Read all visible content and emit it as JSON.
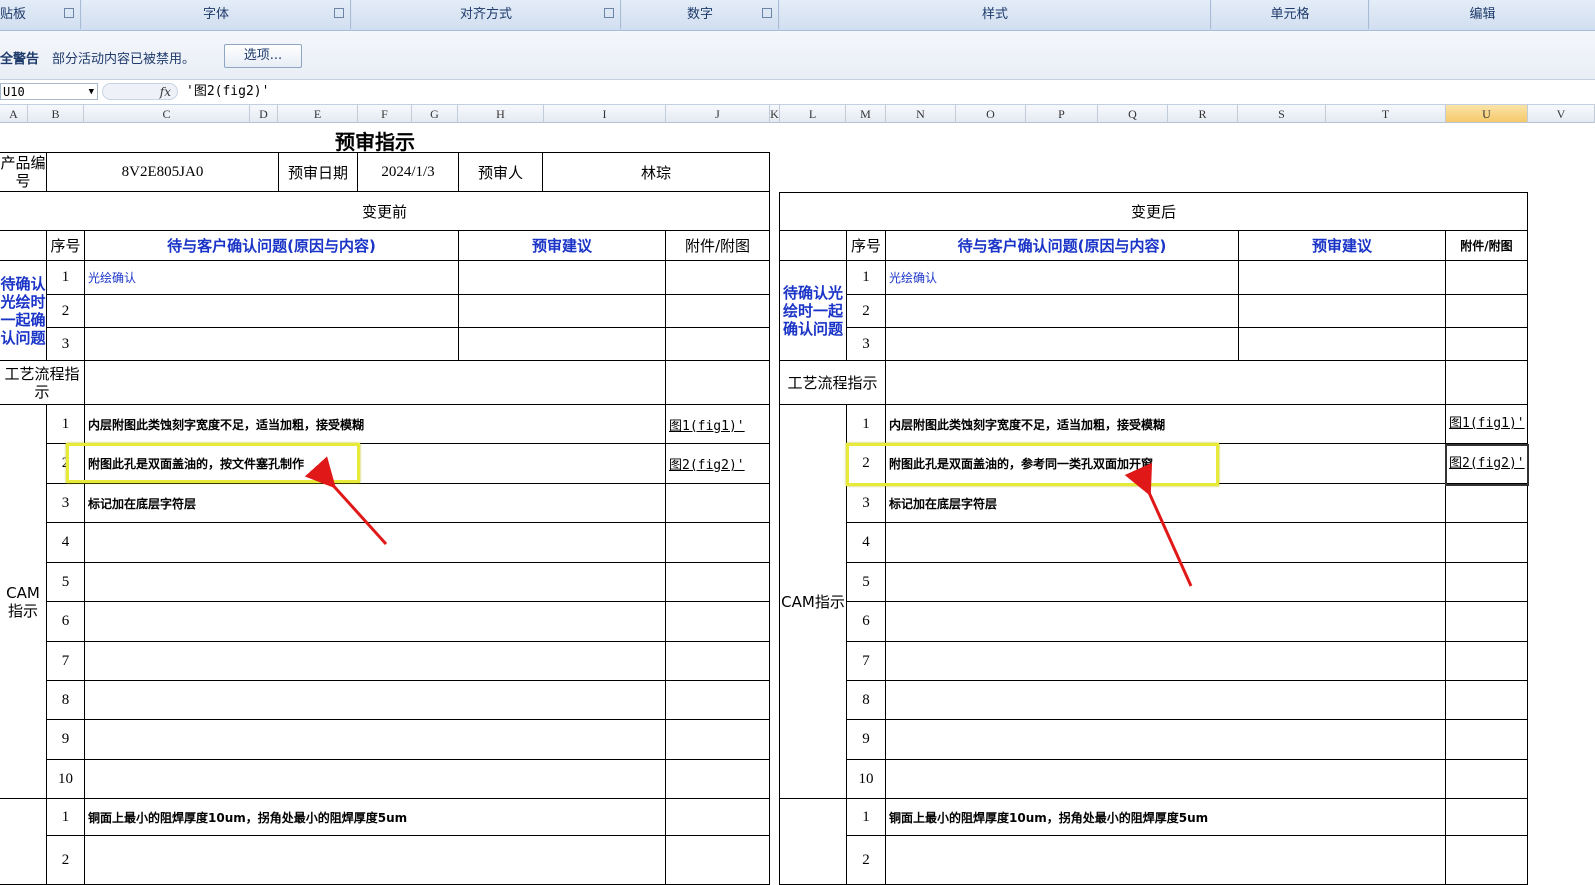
{
  "ribbon": {
    "groups": [
      {
        "label": "贴板"
      },
      {
        "label": "字体"
      },
      {
        "label": "对齐方式"
      },
      {
        "label": "数字"
      },
      {
        "label": "样式"
      },
      {
        "label": "单元格"
      },
      {
        "label": "编辑"
      }
    ]
  },
  "security": {
    "title": "全警告",
    "message": "部分活动内容已被禁用。",
    "options_button": "选项..."
  },
  "formula_bar": {
    "name_box": "U10",
    "fx_label": "fx",
    "content": "'图2(fig2)'"
  },
  "columns": [
    "A",
    "B",
    "C",
    "D",
    "E",
    "F",
    "G",
    "H",
    "I",
    "J",
    "K",
    "L",
    "M",
    "N",
    "O",
    "P",
    "Q",
    "R",
    "S",
    "T",
    "U",
    "V"
  ],
  "selected_column": "U",
  "sheet": {
    "title": "预审指示",
    "header_row": {
      "product_label": "产品编号",
      "product_value": "8V2E805JA0",
      "date_label": "预审日期",
      "date_value": "2024/1/3",
      "reviewer_label": "预审人",
      "reviewer_value": "林琮"
    },
    "before_title": "变更前",
    "after_title": "变更后",
    "col_seq": "序号",
    "col_question": "待与客户确认问题(原因与内容)",
    "col_suggest": "预审建议",
    "col_attach": "附件/附图",
    "col_attach_after": "附件/附图",
    "confirm_label_before": "待确认光绘时一起确认问题",
    "confirm_label_after": "待确认光绘时一起确认问题",
    "confirm_rows": [
      {
        "seq": "1",
        "text": "光绘确认"
      },
      {
        "seq": "2",
        "text": ""
      },
      {
        "seq": "3",
        "text": ""
      }
    ],
    "process_label": "工艺流程指示",
    "cam_label": "CAM指示",
    "cam_rows_before": [
      {
        "seq": "1",
        "text": "内层附图此类蚀刻字宽度不足，适当加粗，接受模糊",
        "attach": "图1(fig1)'"
      },
      {
        "seq": "2",
        "text": "附图此孔是双面盖油的，按文件塞孔制作",
        "attach": "图2(fig2)'"
      },
      {
        "seq": "3",
        "text": "标记加在底层字符层",
        "attach": ""
      },
      {
        "seq": "4",
        "text": "",
        "attach": ""
      },
      {
        "seq": "5",
        "text": "",
        "attach": ""
      },
      {
        "seq": "6",
        "text": "",
        "attach": ""
      },
      {
        "seq": "7",
        "text": "",
        "attach": ""
      },
      {
        "seq": "8",
        "text": "",
        "attach": ""
      },
      {
        "seq": "9",
        "text": "",
        "attach": ""
      },
      {
        "seq": "10",
        "text": "",
        "attach": ""
      }
    ],
    "cam_rows_after": [
      {
        "seq": "1",
        "text": "内层附图此类蚀刻字宽度不足，适当加粗，接受模糊",
        "attach": "图1(fig1)'"
      },
      {
        "seq": "2",
        "text": "附图此孔是双面盖油的，参考同一类孔双面加开窗",
        "attach": "图2(fig2)'"
      },
      {
        "seq": "3",
        "text": "标记加在底层字符层",
        "attach": ""
      },
      {
        "seq": "4",
        "text": "",
        "attach": ""
      },
      {
        "seq": "5",
        "text": "",
        "attach": ""
      },
      {
        "seq": "6",
        "text": "",
        "attach": ""
      },
      {
        "seq": "7",
        "text": "",
        "attach": ""
      },
      {
        "seq": "8",
        "text": "",
        "attach": ""
      },
      {
        "seq": "9",
        "text": "",
        "attach": ""
      },
      {
        "seq": "10",
        "text": "",
        "attach": ""
      }
    ],
    "bottom_rows": [
      {
        "seq": "1",
        "text": "铜面上最小的阻焊厚度10um，拐角处最小的阻焊厚度5um"
      },
      {
        "seq": "2",
        "text": ""
      }
    ]
  },
  "colors": {
    "accent_blue": "#1a34c8",
    "highlight": "#e8ea3a",
    "arrow": "#e01818"
  }
}
